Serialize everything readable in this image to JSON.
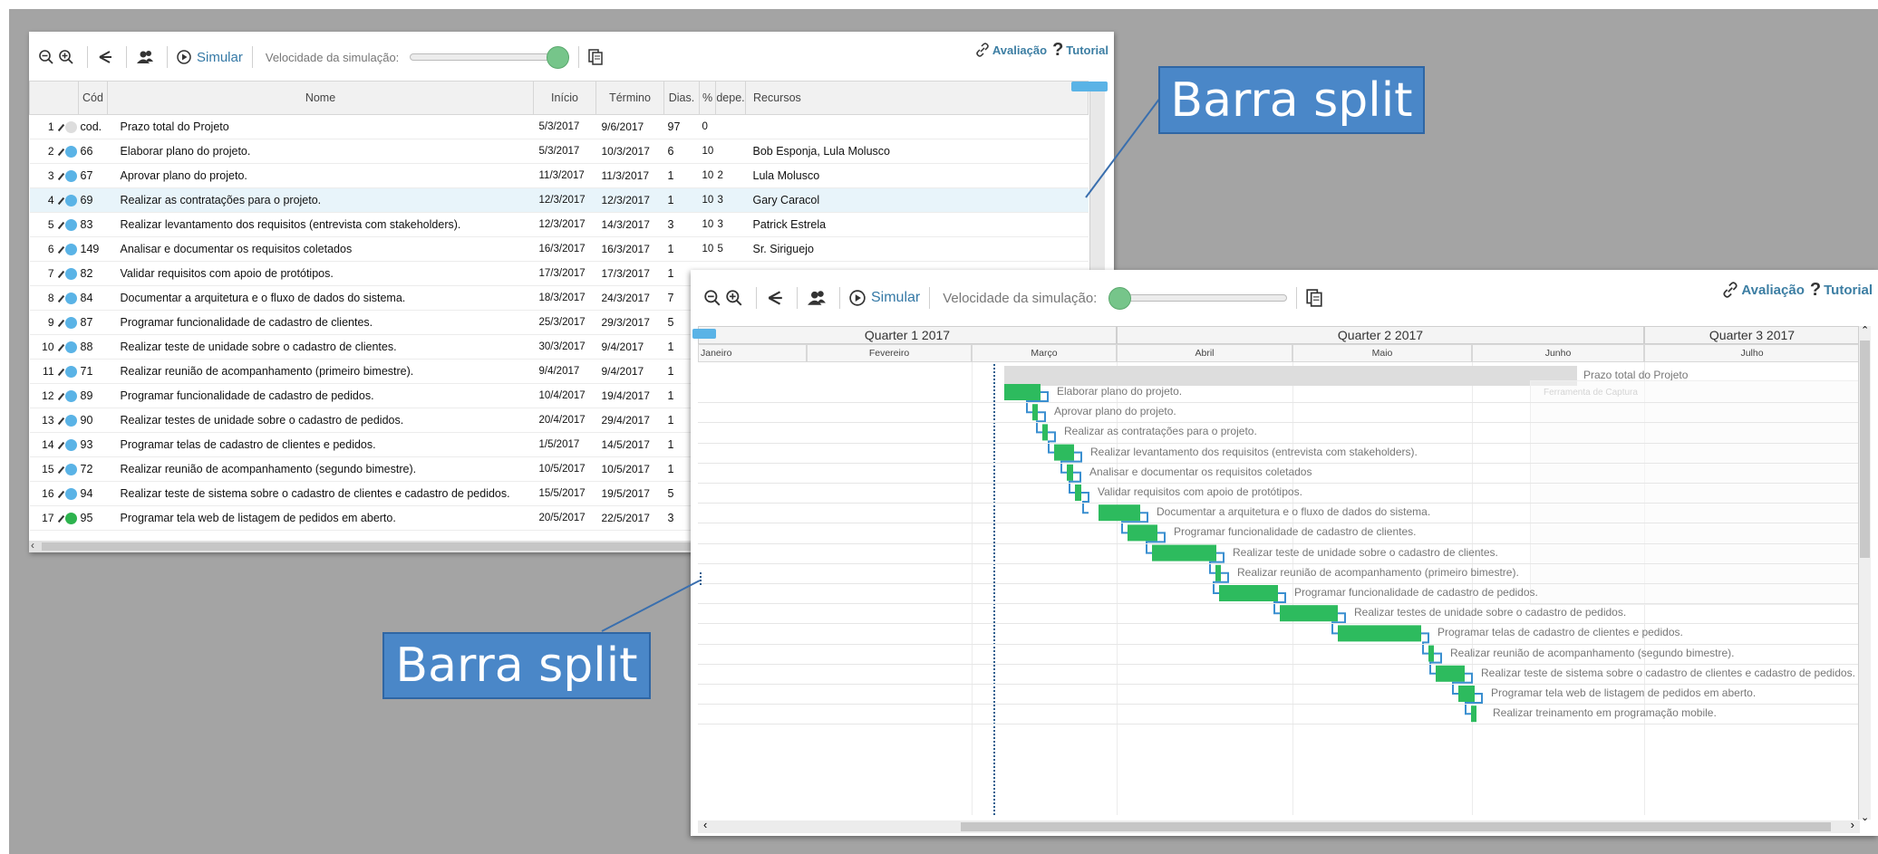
{
  "toolbar": {
    "simulate_label": "Simular",
    "speed_label": "Velocidade da simulação:",
    "evaluation_label": "Avaliação",
    "tutorial_label": "Tutorial",
    "icons": [
      "zoom-out-icon",
      "zoom-in-icon",
      "share-icon",
      "resources-icon",
      "play-icon",
      "copy-icon",
      "link-icon",
      "help-icon"
    ]
  },
  "grid": {
    "columns": [
      "Cód",
      "Nome",
      "Início",
      "Término",
      "Dias.",
      "%",
      "depe.",
      "Recursos"
    ],
    "rows": [
      {
        "num": "1",
        "code": "cod.",
        "name": "Prazo total do Projeto",
        "start": "5/3/2017",
        "end": "9/6/2017",
        "days": "97",
        "pct": "0",
        "dep": "",
        "res": "",
        "muted": true
      },
      {
        "num": "2",
        "code": "66",
        "name": "Elaborar plano do projeto.",
        "start": "5/3/2017",
        "end": "10/3/2017",
        "days": "6",
        "pct": "10",
        "dep": "",
        "res": "Bob Esponja, Lula Molusco"
      },
      {
        "num": "3",
        "code": "67",
        "name": "Aprovar plano do projeto.",
        "start": "11/3/2017",
        "end": "11/3/2017",
        "days": "1",
        "pct": "10",
        "dep": "2",
        "res": "Lula Molusco"
      },
      {
        "num": "4",
        "code": "69",
        "name": "Realizar as contratações para o projeto.",
        "start": "12/3/2017",
        "end": "12/3/2017",
        "days": "1",
        "pct": "10",
        "dep": "3",
        "res": "Gary Caracol"
      },
      {
        "num": "5",
        "code": "83",
        "name": "Realizar levantamento dos requisitos (entrevista com stakeholders).",
        "start": "12/3/2017",
        "end": "14/3/2017",
        "days": "3",
        "pct": "10",
        "dep": "3",
        "res": "Patrick Estrela"
      },
      {
        "num": "6",
        "code": "149",
        "name": "Analisar e documentar os requisitos coletados",
        "start": "16/3/2017",
        "end": "16/3/2017",
        "days": "1",
        "pct": "10",
        "dep": "5",
        "res": "Sr. Siriguejo"
      },
      {
        "num": "7",
        "code": "82",
        "name": "Validar requisitos com apoio de protótipos.",
        "start": "17/3/2017",
        "end": "17/3/2017",
        "days": "1",
        "pct": "",
        "dep": "",
        "res": ""
      },
      {
        "num": "8",
        "code": "84",
        "name": "Documentar a arquitetura e o fluxo de dados do sistema.",
        "start": "18/3/2017",
        "end": "24/3/2017",
        "days": "7",
        "pct": "",
        "dep": "",
        "res": ""
      },
      {
        "num": "9",
        "code": "87",
        "name": "Programar funcionalidade de cadastro de clientes.",
        "start": "25/3/2017",
        "end": "29/3/2017",
        "days": "5",
        "pct": "",
        "dep": "",
        "res": ""
      },
      {
        "num": "10",
        "code": "88",
        "name": "Realizar teste de unidade sobre o cadastro de clientes.",
        "start": "30/3/2017",
        "end": "9/4/2017",
        "days": "1",
        "pct": "",
        "dep": "",
        "res": ""
      },
      {
        "num": "11",
        "code": "71",
        "name": "Realizar reunião de acompanhamento (primeiro bimestre).",
        "start": "9/4/2017",
        "end": "9/4/2017",
        "days": "1",
        "pct": "",
        "dep": "",
        "res": ""
      },
      {
        "num": "12",
        "code": "89",
        "name": "Programar funcionalidade de cadastro de pedidos.",
        "start": "10/4/2017",
        "end": "19/4/2017",
        "days": "1",
        "pct": "",
        "dep": "",
        "res": ""
      },
      {
        "num": "13",
        "code": "90",
        "name": "Realizar testes de unidade sobre o cadastro de pedidos.",
        "start": "20/4/2017",
        "end": "29/4/2017",
        "days": "1",
        "pct": "",
        "dep": "",
        "res": ""
      },
      {
        "num": "14",
        "code": "93",
        "name": "Programar telas de cadastro de clientes e pedidos.",
        "start": "1/5/2017",
        "end": "14/5/2017",
        "days": "1",
        "pct": "",
        "dep": "",
        "res": ""
      },
      {
        "num": "15",
        "code": "72",
        "name": "Realizar reunião de acompanhamento (segundo bimestre).",
        "start": "10/5/2017",
        "end": "10/5/2017",
        "days": "1",
        "pct": "",
        "dep": "",
        "res": ""
      },
      {
        "num": "16",
        "code": "94",
        "name": "Realizar teste de sistema sobre o cadastro de clientes e cadastro de pedidos.",
        "start": "15/5/2017",
        "end": "19/5/2017",
        "days": "5",
        "pct": "",
        "dep": "",
        "res": ""
      },
      {
        "num": "17",
        "code": "95",
        "name": "Programar tela web de listagem de pedidos em aberto.",
        "start": "20/5/2017",
        "end": "22/5/2017",
        "days": "3",
        "pct": "",
        "dep": "",
        "res": ""
      }
    ]
  },
  "gantt": {
    "quarters": [
      "Quarter 1 2017",
      "Quarter 2 2017",
      "Quarter 3 2017"
    ],
    "months": [
      "Janeiro",
      "Fevereiro",
      "Março",
      "Abril",
      "Maio",
      "Junho",
      "Julho"
    ],
    "summary_label": "Prazo total do Projeto",
    "ghost_label": "Ferramenta de Captura",
    "tasks": [
      "Elaborar plano do projeto.",
      "Aprovar plano do projeto.",
      "Realizar as contratações para o projeto.",
      "Realizar levantamento dos requisitos (entrevista com stakeholders).",
      "Analisar e documentar os requisitos coletados",
      "Validar requisitos com apoio de protótipos.",
      "Documentar a arquitetura e o fluxo de dados do sistema.",
      "Programar funcionalidade de cadastro de clientes.",
      "Realizar teste de unidade sobre o cadastro de clientes.",
      "Realizar reunião de acompanhamento (primeiro bimestre).",
      "Programar funcionalidade de cadastro de pedidos.",
      "Realizar testes de unidade sobre o cadastro de pedidos.",
      "Programar telas de cadastro de clientes e pedidos.",
      "Realizar reunião de acompanhamento (segundo bimestre).",
      "Realizar teste de sistema sobre o cadastro de clientes e cadastro de pedidos.",
      "Programar tela web de listagem de pedidos em aberto.",
      "Realizar treinamento em programação mobile."
    ]
  },
  "callouts": {
    "top": "Barra split",
    "bottom": "Barra split"
  },
  "colors": {
    "background": "#a4a4a4",
    "bar": "#2dbb5e",
    "callout": "#4a87c8",
    "link": "#3c7ea3",
    "status_dot": "#5ab3e6",
    "done_dot": "#2db34e"
  }
}
